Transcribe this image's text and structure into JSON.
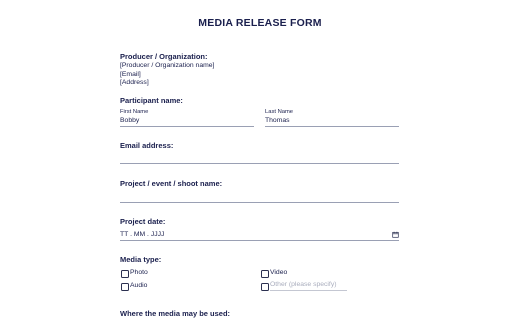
{
  "form": {
    "title": "MEDIA RELEASE FORM"
  },
  "producer": {
    "label": "Producer / Organization:",
    "name": "[Producer / Organization name]",
    "email": "[Email]",
    "address": "[Address]"
  },
  "participant": {
    "label": "Participant name:",
    "first_name_label": "First Name",
    "first_name_value": "Bobby",
    "last_name_label": "Last Name",
    "last_name_value": "Thomas"
  },
  "email": {
    "label": "Email address:",
    "value": ""
  },
  "project_name": {
    "label": "Project / event / shoot name:",
    "value": ""
  },
  "project_date": {
    "label": "Project date:",
    "placeholder": "TT . MM . JJJJ",
    "icon": "calendar-icon"
  },
  "media_type": {
    "label": "Media type:",
    "options": [
      {
        "label": "Photo",
        "checked": false
      },
      {
        "label": "Video",
        "checked": false
      },
      {
        "label": "Audio",
        "checked": false
      },
      {
        "label": "Other (please specify)",
        "checked": false,
        "placeholder": true
      }
    ]
  },
  "usage": {
    "label": "Where the media may be used:"
  }
}
